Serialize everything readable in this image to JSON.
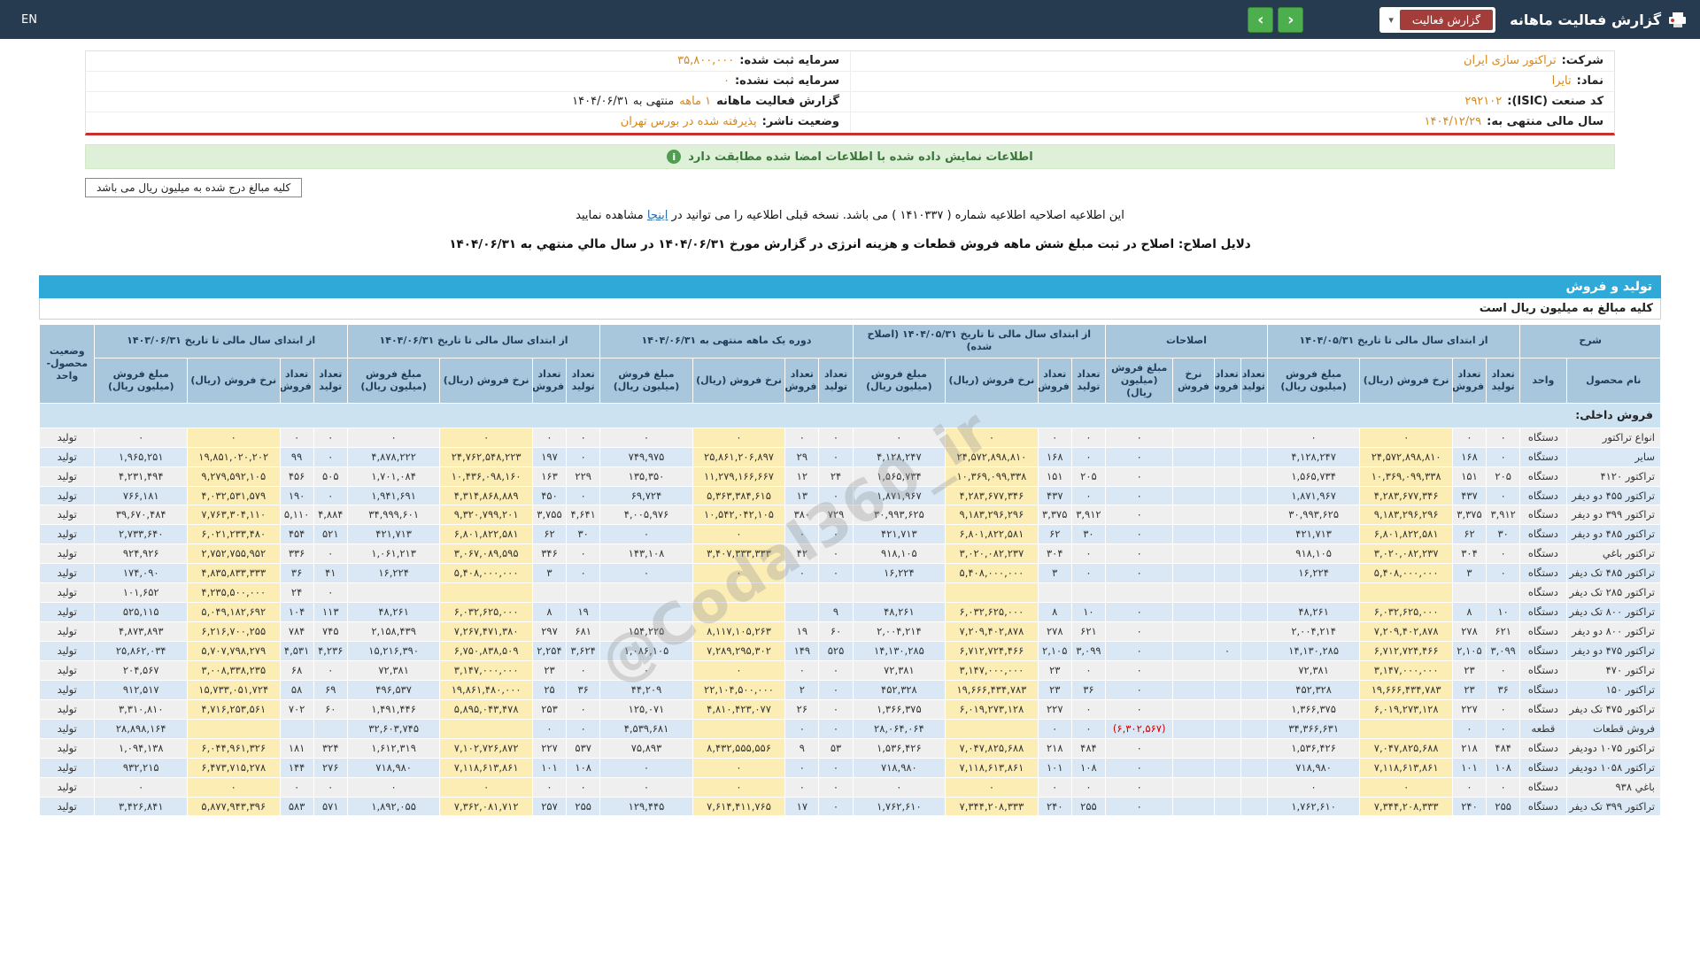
{
  "colors": {
    "topbar": "#263a50",
    "accent_orange": "#d6871d",
    "section_blue": "#2fa9d8",
    "alert_green_bg": "#dff0d8",
    "alert_green_text": "#3c763d",
    "negative_red": "#cc0000",
    "rate_yellow": "#fcedb4",
    "report_btn_red": "#a33d3a",
    "nav_green": "#4cae4c",
    "info_red_line": "#c9302c"
  },
  "watermark": "@Codal360_ir",
  "header": {
    "title": "گزارش فعالیت ماهانه",
    "report_button_label": "گزارش فعالیت",
    "caret": "▾",
    "nav_prev": "‹",
    "nav_next": "›",
    "lang_label": "EN"
  },
  "info": {
    "right": [
      {
        "label": "شرکت:",
        "value": "تراکتور سازی ایران",
        "suffix": ""
      },
      {
        "label": "نماد:",
        "value": "تایرا",
        "suffix": ""
      },
      {
        "label": "کد صنعت (ISIC):",
        "value": "۲۹۲۱۰۲",
        "suffix": ""
      },
      {
        "label": "سال مالی منتهی به:",
        "value": "۱۴۰۴/۱۲/۲۹",
        "suffix": ""
      }
    ],
    "left": [
      {
        "label": "سرمایه ثبت شده:",
        "value": "۳۵,۸۰۰,۰۰۰",
        "suffix": ""
      },
      {
        "label": "سرمایه ثبت نشده:",
        "value": "۰",
        "suffix": ""
      },
      {
        "label": "گزارش فعالیت ماهانه",
        "value": "۱ ماهه",
        "suffix": "منتهی به ۱۴۰۴/۰۶/۳۱"
      },
      {
        "label": "وضعیت ناشر:",
        "value": "پذیرفته شده در بورس تهران",
        "suffix": ""
      }
    ]
  },
  "alert": {
    "icon": "i",
    "text": "اطلاعات نمایش داده شده با اطلاعات امضا شده مطابقت دارد"
  },
  "amounts_box": "کلیه مبالغ درج شده به میلیون ریال می باشد",
  "notice": {
    "line1_pre": "این اطلاعیه اصلاحیه اطلاعیه شماره ( ۱۴۱۰۳۳۷ ) می باشد. نسخه قبلی اطلاعیه را می توانید در ",
    "line1_link": "اینجا",
    "line1_post": " مشاهده نمایید",
    "line2": "دلایل اصلاح: اصلاح در ثبت مبلغ شش ماهه فروش قطعات و هزینه انرژی در گزارش مورخ ۱۴۰۴/۰۶/۳۱ در سال مالي منتهي به ۱۴۰۴/۰۶/۳۱"
  },
  "section": {
    "title": "تولید و فروش",
    "units_note": "کلیه مبالغ به میلیون ریال است"
  },
  "table": {
    "desc_header": "شرح",
    "col_product": "نام محصول",
    "col_unit": "واحد",
    "col_status": "وضعیت محصول-واحد",
    "section_row": "فروش داخلی:",
    "groups": [
      {
        "label": "از ابتدای سال مالی تا تاریخ ۱۴۰۴/۰۵/۳۱",
        "subcols": [
          "تعداد تولید",
          "تعداد فروش",
          "نرخ فروش (ریال)",
          "مبلغ فروش (میلیون ریال)"
        ]
      },
      {
        "label": "اصلاحات",
        "subcols": [
          "تعداد تولید",
          "تعداد فروش",
          "نرخ فروش",
          "مبلغ فروش (میلیون ریال)"
        ]
      },
      {
        "label": "از ابتدای سال مالی تا تاریخ ۱۴۰۴/۰۵/۳۱ (اصلاح شده)",
        "subcols": [
          "تعداد تولید",
          "تعداد فروش",
          "نرخ فروش (ریال)",
          "مبلغ فروش (میلیون ریال)"
        ]
      },
      {
        "label": "دوره یک ماهه منتهی به ۱۴۰۴/۰۶/۳۱",
        "subcols": [
          "تعداد تولید",
          "تعداد فروش",
          "نرخ فروش (ریال)",
          "مبلغ فروش (میلیون ریال)"
        ]
      },
      {
        "label": "از ابتدای سال مالی تا تاریخ ۱۴۰۴/۰۶/۳۱",
        "subcols": [
          "تعداد تولید",
          "تعداد فروش",
          "نرخ فروش (ریال)",
          "مبلغ فروش (میلیون ریال)"
        ]
      },
      {
        "label": "از ابتدای سال مالی تا تاریخ ۱۴۰۳/۰۶/۳۱",
        "subcols": [
          "تعداد تولید",
          "تعداد فروش",
          "نرخ فروش (ریال)",
          "مبلغ فروش (میلیون ریال)"
        ]
      }
    ],
    "rows": [
      {
        "name": "انواع تراکتور",
        "unit": "دستگاه",
        "status": "تولید",
        "cells": [
          "۰",
          "۰",
          "۰",
          "۰",
          "",
          "",
          "",
          "۰",
          "۰",
          "۰",
          "۰",
          "۰",
          "۰",
          "۰",
          "۰",
          "۰",
          "۰",
          "۰",
          "۰",
          "۰",
          "۰",
          "۰",
          "۰",
          "۰"
        ]
      },
      {
        "name": "سایر",
        "unit": "دستگاه",
        "status": "تولید",
        "cells": [
          "۰",
          "۱۶۸",
          "۲۴,۵۷۲,۸۹۸,۸۱۰",
          "۴,۱۲۸,۲۴۷",
          "",
          "",
          "",
          "۰",
          "۰",
          "۱۶۸",
          "۲۴,۵۷۲,۸۹۸,۸۱۰",
          "۴,۱۲۸,۲۴۷",
          "۰",
          "۲۹",
          "۲۵,۸۶۱,۲۰۶,۸۹۷",
          "۷۴۹,۹۷۵",
          "۰",
          "۱۹۷",
          "۲۴,۷۶۲,۵۴۸,۲۲۳",
          "۴,۸۷۸,۲۲۲",
          "۰",
          "۹۹",
          "۱۹,۸۵۱,۰۲۰,۲۰۲",
          "۱,۹۶۵,۲۵۱"
        ]
      },
      {
        "name": "تراکتور ۴۱۲۰",
        "unit": "دستگاه",
        "status": "تولید",
        "cells": [
          "۲۰۵",
          "۱۵۱",
          "۱۰,۳۶۹,۰۹۹,۳۳۸",
          "۱,۵۶۵,۷۳۴",
          "",
          "",
          "",
          "۰",
          "۲۰۵",
          "۱۵۱",
          "۱۰,۳۶۹,۰۹۹,۳۳۸",
          "۱,۵۶۵,۷۳۴",
          "۲۴",
          "۱۲",
          "۱۱,۲۷۹,۱۶۶,۶۶۷",
          "۱۳۵,۳۵۰",
          "۲۲۹",
          "۱۶۳",
          "۱۰,۴۳۶,۰۹۸,۱۶۰",
          "۱,۷۰۱,۰۸۴",
          "۵۰۵",
          "۴۵۶",
          "۹,۲۷۹,۵۹۲,۱۰۵",
          "۴,۲۳۱,۴۹۴"
        ]
      },
      {
        "name": "تراکتور ۴۵۵ دو دیفر",
        "unit": "دستگاه",
        "status": "تولید",
        "cells": [
          "۰",
          "۴۳۷",
          "۴,۲۸۳,۶۷۷,۳۴۶",
          "۱,۸۷۱,۹۶۷",
          "",
          "",
          "",
          "۰",
          "۰",
          "۴۳۷",
          "۴,۲۸۳,۶۷۷,۳۴۶",
          "۱,۸۷۱,۹۶۷",
          "۰",
          "۱۳",
          "۵,۳۶۳,۳۸۴,۶۱۵",
          "۶۹,۷۲۴",
          "۰",
          "۴۵۰",
          "۴,۳۱۴,۸۶۸,۸۸۹",
          "۱,۹۴۱,۶۹۱",
          "۰",
          "۱۹۰",
          "۴,۰۳۲,۵۳۱,۵۷۹",
          "۷۶۶,۱۸۱"
        ]
      },
      {
        "name": "تراکتور ۳۹۹ دو دیفر",
        "unit": "دستگاه",
        "status": "تولید",
        "cells": [
          "۳,۹۱۲",
          "۳,۳۷۵",
          "۹,۱۸۳,۲۹۶,۲۹۶",
          "۳۰,۹۹۳,۶۲۵",
          "",
          "",
          "",
          "۰",
          "۳,۹۱۲",
          "۳,۳۷۵",
          "۹,۱۸۳,۲۹۶,۲۹۶",
          "۳۰,۹۹۳,۶۲۵",
          "۷۲۹",
          "۳۸۰",
          "۱۰,۵۴۲,۰۴۲,۱۰۵",
          "۴,۰۰۵,۹۷۶",
          "۴,۶۴۱",
          "۳,۷۵۵",
          "۹,۳۲۰,۷۹۹,۲۰۱",
          "۳۴,۹۹۹,۶۰۱",
          "۴,۸۸۴",
          "۵,۱۱۰",
          "۷,۷۶۳,۳۰۴,۱۱۰",
          "۳۹,۶۷۰,۴۸۴"
        ]
      },
      {
        "name": "تراکتور ۴۸۵ دو دیفر",
        "unit": "دستگاه",
        "status": "تولید",
        "cells": [
          "۳۰",
          "۶۲",
          "۶,۸۰۱,۸۲۲,۵۸۱",
          "۴۲۱,۷۱۳",
          "",
          "",
          "",
          "۰",
          "۳۰",
          "۶۲",
          "۶,۸۰۱,۸۲۲,۵۸۱",
          "۴۲۱,۷۱۳",
          "۰",
          "۰",
          "۰",
          "۰",
          "۳۰",
          "۶۲",
          "۶,۸۰۱,۸۲۲,۵۸۱",
          "۴۲۱,۷۱۳",
          "۵۲۱",
          "۴۵۴",
          "۶,۰۲۱,۲۳۳,۴۸۰",
          "۲,۷۳۳,۶۴۰"
        ]
      },
      {
        "name": "تراکتور باغي",
        "unit": "دستگاه",
        "status": "تولید",
        "cells": [
          "۰",
          "۳۰۴",
          "۳,۰۲۰,۰۸۲,۲۳۷",
          "۹۱۸,۱۰۵",
          "",
          "",
          "",
          "۰",
          "۰",
          "۳۰۴",
          "۳,۰۲۰,۰۸۲,۲۳۷",
          "۹۱۸,۱۰۵",
          "۰",
          "۴۲",
          "۳,۴۰۷,۳۳۳,۳۳۳",
          "۱۴۳,۱۰۸",
          "۰",
          "۳۴۶",
          "۳,۰۶۷,۰۸۹,۵۹۵",
          "۱,۰۶۱,۲۱۳",
          "۰",
          "۳۳۶",
          "۲,۷۵۲,۷۵۵,۹۵۲",
          "۹۲۴,۹۲۶"
        ]
      },
      {
        "name": "تراکتور ۴۸۵ تک دیفر",
        "unit": "دستگاه",
        "status": "تولید",
        "cells": [
          "۰",
          "۳",
          "۵,۴۰۸,۰۰۰,۰۰۰",
          "۱۶,۲۲۴",
          "",
          "",
          "",
          "۰",
          "۰",
          "۳",
          "۵,۴۰۸,۰۰۰,۰۰۰",
          "۱۶,۲۲۴",
          "۰",
          "۰",
          "۰",
          "۰",
          "۰",
          "۳",
          "۵,۴۰۸,۰۰۰,۰۰۰",
          "۱۶,۲۲۴",
          "۴۱",
          "۳۶",
          "۴,۸۳۵,۸۳۳,۳۳۳",
          "۱۷۴,۰۹۰"
        ]
      },
      {
        "name": "تراکتور ۲۸۵ تک دیفر",
        "unit": "دستگاه",
        "status": "تولید",
        "cells": [
          "",
          "",
          "",
          "",
          "",
          "",
          "",
          "",
          "",
          "",
          "",
          "",
          "",
          "",
          "",
          "",
          "",
          "",
          "",
          "",
          "۰",
          "۲۴",
          "۴,۲۳۵,۵۰۰,۰۰۰",
          "۱۰۱,۶۵۲"
        ]
      },
      {
        "name": "تراکتور ۸۰۰ تک دیفر",
        "unit": "دستگاه",
        "status": "تولید",
        "cells": [
          "۱۰",
          "۸",
          "۶,۰۳۲,۶۲۵,۰۰۰",
          "۴۸,۲۶۱",
          "",
          "",
          "",
          "۰",
          "۱۰",
          "۸",
          "۶,۰۳۲,۶۲۵,۰۰۰",
          "۴۸,۲۶۱",
          "۹",
          "",
          "",
          "",
          "۱۹",
          "۸",
          "۶,۰۳۲,۶۲۵,۰۰۰",
          "۴۸,۲۶۱",
          "۱۱۳",
          "۱۰۴",
          "۵,۰۴۹,۱۸۲,۶۹۲",
          "۵۲۵,۱۱۵"
        ]
      },
      {
        "name": "تراکتور ۸۰۰ دو دیفر",
        "unit": "دستگاه",
        "status": "تولید",
        "cells": [
          "۶۲۱",
          "۲۷۸",
          "۷,۲۰۹,۴۰۲,۸۷۸",
          "۲,۰۰۴,۲۱۴",
          "",
          "",
          "",
          "۰",
          "۶۲۱",
          "۲۷۸",
          "۷,۲۰۹,۴۰۲,۸۷۸",
          "۲,۰۰۴,۲۱۴",
          "۶۰",
          "۱۹",
          "۸,۱۱۷,۱۰۵,۲۶۳",
          "۱۵۴,۲۲۵",
          "۶۸۱",
          "۲۹۷",
          "۷,۲۶۷,۴۷۱,۳۸۰",
          "۲,۱۵۸,۴۳۹",
          "۷۴۵",
          "۷۸۴",
          "۶,۲۱۶,۷۰۰,۲۵۵",
          "۴,۸۷۳,۸۹۳"
        ]
      },
      {
        "name": "تراکتور ۴۷۵ دو دیفر",
        "unit": "دستگاه",
        "status": "تولید",
        "cells": [
          "۳,۰۹۹",
          "۲,۱۰۵",
          "۶,۷۱۲,۷۲۴,۴۶۶",
          "۱۴,۱۳۰,۲۸۵",
          "",
          "۰",
          "",
          "۰",
          "۳,۰۹۹",
          "۲,۱۰۵",
          "۶,۷۱۲,۷۲۴,۴۶۶",
          "۱۴,۱۳۰,۲۸۵",
          "۵۲۵",
          "۱۴۹",
          "۷,۲۸۹,۲۹۵,۳۰۲",
          "۱,۰۸۶,۱۰۵",
          "۳,۶۲۴",
          "۲,۲۵۴",
          "۶,۷۵۰,۸۳۸,۵۰۹",
          "۱۵,۲۱۶,۳۹۰",
          "۴,۲۳۶",
          "۴,۵۳۱",
          "۵,۷۰۷,۷۹۸,۲۷۹",
          "۲۵,۸۶۲,۰۳۴"
        ]
      },
      {
        "name": "تراکتور ۴۷۰",
        "unit": "دستگاه",
        "status": "تولید",
        "cells": [
          "۰",
          "۲۳",
          "۳,۱۴۷,۰۰۰,۰۰۰",
          "۷۲,۳۸۱",
          "",
          "",
          "",
          "۰",
          "۰",
          "۲۳",
          "۳,۱۴۷,۰۰۰,۰۰۰",
          "۷۲,۳۸۱",
          "۰",
          "۰",
          "۰",
          "۰",
          "۰",
          "۲۳",
          "۳,۱۴۷,۰۰۰,۰۰۰",
          "۷۲,۳۸۱",
          "۰",
          "۶۸",
          "۳,۰۰۸,۳۳۸,۲۳۵",
          "۲۰۴,۵۶۷"
        ]
      },
      {
        "name": "تراکتور ۱۵۰",
        "unit": "دستگاه",
        "status": "تولید",
        "cells": [
          "۳۶",
          "۲۳",
          "۱۹,۶۶۶,۴۳۴,۷۸۳",
          "۴۵۲,۳۲۸",
          "",
          "",
          "",
          "۰",
          "۳۶",
          "۲۳",
          "۱۹,۶۶۶,۴۳۴,۷۸۳",
          "۴۵۲,۳۲۸",
          "۰",
          "۲",
          "۲۲,۱۰۴,۵۰۰,۰۰۰",
          "۴۴,۲۰۹",
          "۳۶",
          "۲۵",
          "۱۹,۸۶۱,۴۸۰,۰۰۰",
          "۴۹۶,۵۳۷",
          "۶۹",
          "۵۸",
          "۱۵,۷۳۳,۰۵۱,۷۲۴",
          "۹۱۲,۵۱۷"
        ]
      },
      {
        "name": "تراکتور ۴۷۵ تک دیفر",
        "unit": "دستگاه",
        "status": "تولید",
        "cells": [
          "۰",
          "۲۲۷",
          "۶,۰۱۹,۲۷۳,۱۲۸",
          "۱,۳۶۶,۳۷۵",
          "",
          "",
          "",
          "۰",
          "۰",
          "۲۲۷",
          "۶,۰۱۹,۲۷۳,۱۲۸",
          "۱,۳۶۶,۳۷۵",
          "۰",
          "۲۶",
          "۴,۸۱۰,۴۲۳,۰۷۷",
          "۱۲۵,۰۷۱",
          "۰",
          "۲۵۳",
          "۵,۸۹۵,۰۴۳,۴۷۸",
          "۱,۴۹۱,۴۴۶",
          "۶۰",
          "۷۰۲",
          "۴,۷۱۶,۲۵۳,۵۶۱",
          "۳,۳۱۰,۸۱۰"
        ]
      },
      {
        "name": "فروش قطعات",
        "unit": "قطعه",
        "status": "تولید",
        "cells": [
          "۰",
          "۰",
          "",
          "۳۴,۳۶۶,۶۳۱",
          "",
          "",
          "",
          "(۶,۳۰۲,۵۶۷)",
          "۰",
          "۰",
          "",
          "۲۸,۰۶۴,۰۶۴",
          "۰",
          "۰",
          "",
          "۴,۵۳۹,۶۸۱",
          "۰",
          "۰",
          "",
          "۳۲,۶۰۳,۷۴۵",
          "",
          "",
          "",
          "۲۸,۸۹۸,۱۶۴"
        ]
      },
      {
        "name": "تراکتور ۱۰۷۵ دودیفر",
        "unit": "دستگاه",
        "status": "تولید",
        "cells": [
          "۴۸۴",
          "۲۱۸",
          "۷,۰۴۷,۸۲۵,۶۸۸",
          "۱,۵۳۶,۴۲۶",
          "",
          "",
          "",
          "۰",
          "۴۸۴",
          "۲۱۸",
          "۷,۰۴۷,۸۲۵,۶۸۸",
          "۱,۵۳۶,۴۲۶",
          "۵۳",
          "۹",
          "۸,۴۳۲,۵۵۵,۵۵۶",
          "۷۵,۸۹۳",
          "۵۳۷",
          "۲۲۷",
          "۷,۱۰۲,۷۲۶,۸۷۲",
          "۱,۶۱۲,۳۱۹",
          "۳۲۴",
          "۱۸۱",
          "۶,۰۴۴,۹۶۱,۳۲۶",
          "۱,۰۹۴,۱۳۸"
        ]
      },
      {
        "name": "تراکتور ۱۰۵۸ دودیفر",
        "unit": "دستگاه",
        "status": "تولید",
        "cells": [
          "۱۰۸",
          "۱۰۱",
          "۷,۱۱۸,۶۱۳,۸۶۱",
          "۷۱۸,۹۸۰",
          "",
          "",
          "",
          "۰",
          "۱۰۸",
          "۱۰۱",
          "۷,۱۱۸,۶۱۳,۸۶۱",
          "۷۱۸,۹۸۰",
          "۰",
          "۰",
          "۰",
          "۰",
          "۱۰۸",
          "۱۰۱",
          "۷,۱۱۸,۶۱۳,۸۶۱",
          "۷۱۸,۹۸۰",
          "۲۷۶",
          "۱۴۴",
          "۶,۴۷۳,۷۱۵,۲۷۸",
          "۹۳۲,۲۱۵"
        ]
      },
      {
        "name": "باغي ۹۳۸",
        "unit": "دستگاه",
        "status": "تولید",
        "cells": [
          "۰",
          "۰",
          "۰",
          "۰",
          "",
          "",
          "",
          "۰",
          "۰",
          "۰",
          "۰",
          "۰",
          "۰",
          "۰",
          "۰",
          "۰",
          "۰",
          "۰",
          "۰",
          "۰",
          "۰",
          "۰",
          "۰",
          "۰"
        ]
      },
      {
        "name": "تراکتور ۳۹۹ تک دیفر",
        "unit": "دستگاه",
        "status": "تولید",
        "cells": [
          "۲۵۵",
          "۲۴۰",
          "۷,۳۴۴,۲۰۸,۳۳۳",
          "۱,۷۶۲,۶۱۰",
          "",
          "",
          "",
          "۰",
          "۲۵۵",
          "۲۴۰",
          "۷,۳۴۴,۲۰۸,۳۳۳",
          "۱,۷۶۲,۶۱۰",
          "۰",
          "۱۷",
          "۷,۶۱۴,۴۱۱,۷۶۵",
          "۱۲۹,۴۴۵",
          "۲۵۵",
          "۲۵۷",
          "۷,۳۶۲,۰۸۱,۷۱۲",
          "۱,۸۹۲,۰۵۵",
          "۵۷۱",
          "۵۸۳",
          "۵,۸۷۷,۹۴۳,۳۹۶",
          "۳,۴۲۶,۸۴۱"
        ]
      }
    ]
  }
}
